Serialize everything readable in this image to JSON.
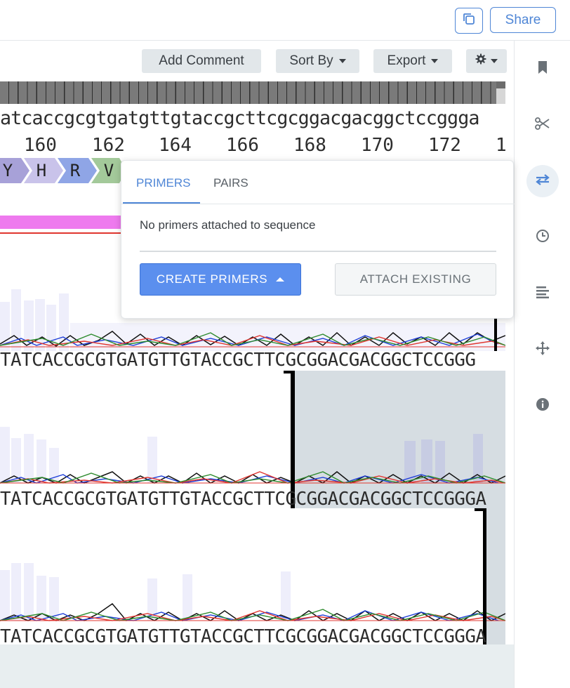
{
  "header": {
    "share_label": "Share",
    "copy_icon": "copy-icon"
  },
  "toolbar": {
    "add_comment": "Add Comment",
    "sort_by": "Sort By",
    "export": "Export",
    "settings_icon": "gear-icon"
  },
  "sidebar": {
    "items": [
      {
        "icon": "bookmark-icon"
      },
      {
        "icon": "scissors-icon"
      },
      {
        "icon": "primers-icon",
        "active": true
      },
      {
        "icon": "history-icon"
      },
      {
        "icon": "align-icon"
      },
      {
        "icon": "move-icon"
      },
      {
        "icon": "info-icon"
      }
    ]
  },
  "sequence": {
    "lowercase": "atcaccgcgtgatgttgtaccgcttcgcggacgacggctccggga",
    "numbers": [
      "160",
      "162",
      "164",
      "166",
      "168",
      "170",
      "172",
      "1"
    ],
    "translation": [
      "Y",
      "H",
      "R",
      "V"
    ],
    "trace_bases": [
      "TATCACCGCGTGATGTTGTACCGCTTCGCGGACGACGGCTCCGGG",
      "TATCACCGCGTGATGTTGTACCGCTTCGCGGACGACGGCTCCGGGA",
      "TATCACCGCGTGATGTTGTACCGCTTCGCGGACGACGGCTCCGGGA"
    ]
  },
  "colors": {
    "accent": "#4f86d6",
    "feature_magenta": "#ee7aee",
    "trace_A": "#2e8b2e",
    "trace_C": "#1e3fd8",
    "trace_G": "#111111",
    "trace_T": "#e0362f"
  },
  "primers_popover": {
    "tabs": [
      "PRIMERS",
      "PAIRS"
    ],
    "active_tab": "PRIMERS",
    "empty_message": "No primers attached to sequence",
    "create_label": "CREATE PRIMERS",
    "attach_label": "ATTACH EXISTING"
  }
}
